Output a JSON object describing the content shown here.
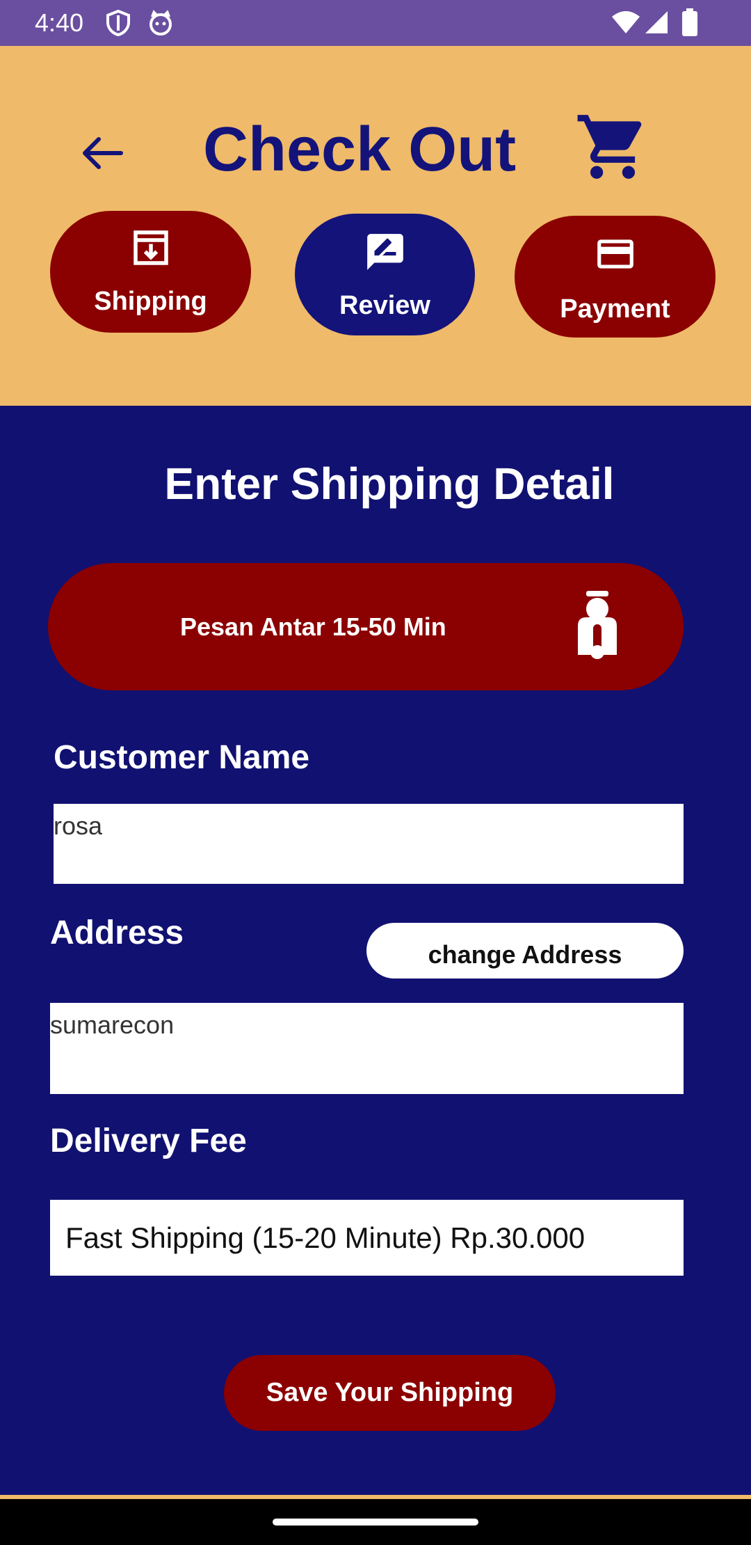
{
  "status_bar": {
    "time": "4:40",
    "icons": [
      "shield-icon",
      "cat-face-icon",
      "wifi-icon",
      "signal-icon",
      "battery-icon"
    ]
  },
  "header": {
    "title": "Check Out",
    "back_icon": "back-arrow-icon",
    "cart_icon": "cart-icon",
    "steps": [
      {
        "label": "Shipping",
        "icon": "archive-download-icon",
        "color": "#8b0000"
      },
      {
        "label": "Review",
        "icon": "edit-note-icon",
        "color": "#13137a"
      },
      {
        "label": "Payment",
        "icon": "credit-card-icon",
        "color": "#8b0000"
      }
    ]
  },
  "main": {
    "title": "Enter Shipping Detail",
    "delivery_option": {
      "label": "Pesan Antar 15-50 Min",
      "icon": "scooter-icon"
    },
    "customer_name": {
      "label": "Customer Name",
      "value": "rosa"
    },
    "address": {
      "label": "Address",
      "value": "sumarecon",
      "change_button": "change Address"
    },
    "delivery_fee": {
      "label": "Delivery Fee",
      "value": "Fast Shipping (15-20 Minute) Rp.30.000"
    },
    "save_button": "Save Your Shipping"
  },
  "colors": {
    "header_bg": "#efba69",
    "main_bg": "#111172",
    "accent_red": "#8b0000",
    "accent_navy": "#13137a",
    "status_bar": "#6a4fa0"
  }
}
